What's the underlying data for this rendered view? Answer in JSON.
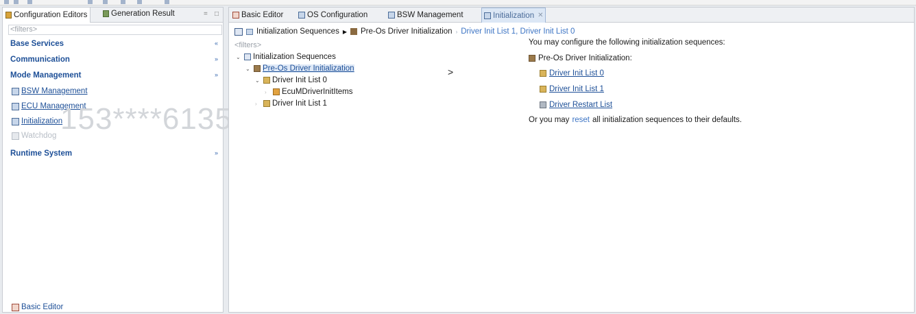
{
  "left_panel": {
    "tabs": [
      {
        "label": "Configuration Editors",
        "active": true,
        "icon": "config-editors-icon"
      },
      {
        "label": "Generation Result",
        "active": false,
        "icon": "generation-result-icon"
      }
    ],
    "filter_placeholder": "<filters>",
    "categories": [
      {
        "label": "Base Services",
        "indicator": "«"
      },
      {
        "label": "Communication",
        "indicator": "»"
      },
      {
        "label": "Mode Management",
        "indicator": "»"
      },
      {
        "label": "Runtime System",
        "indicator": "»"
      }
    ],
    "mode_management_items": [
      {
        "label": "BSW Management",
        "enabled": true
      },
      {
        "label": "ECU Management",
        "enabled": true
      },
      {
        "label": "Initialization",
        "enabled": true
      },
      {
        "label": "Watchdog",
        "enabled": false
      }
    ],
    "watermark": "153****6135",
    "basic_editor_link": "Basic Editor"
  },
  "editor": {
    "tabs": [
      {
        "label": "Basic Editor",
        "active": false
      },
      {
        "label": "OS Configuration",
        "active": false
      },
      {
        "label": "BSW Management",
        "active": false
      },
      {
        "label": "Initialization",
        "active": true,
        "closable": true
      }
    ],
    "breadcrumb": {
      "root": "Initialization Sequences",
      "section": "Pre-Os Driver Initialization",
      "links": "Driver Init List 1, Driver Init List 0"
    },
    "filter_placeholder": "<filters>",
    "tree": [
      {
        "label": "Initialization Sequences",
        "level": 0,
        "expanded": true,
        "icon": "folder-icon"
      },
      {
        "label": "Pre-Os Driver Initialization",
        "level": 1,
        "expanded": true,
        "selected": true,
        "icon": "pre-os-icon"
      },
      {
        "label": "Driver Init List 0",
        "level": 2,
        "expanded": true,
        "icon": "driver-list-icon"
      },
      {
        "label": "EcuMDriverInitItems",
        "level": 3,
        "expanded": false,
        "icon": "init-item-icon"
      },
      {
        "label": "Driver Init List 1",
        "level": 2,
        "expanded": false,
        "icon": "driver-list-icon"
      }
    ],
    "details": {
      "intro": "You may configure the following initialization sequences:",
      "section": "Pre-Os Driver Initialization:",
      "links": [
        "Driver Init List 0",
        "Driver Init List 1",
        "Driver Restart List"
      ],
      "reset_prefix": "Or you may",
      "reset_link": "reset",
      "reset_suffix": "all initialization sequences to their defaults."
    }
  }
}
